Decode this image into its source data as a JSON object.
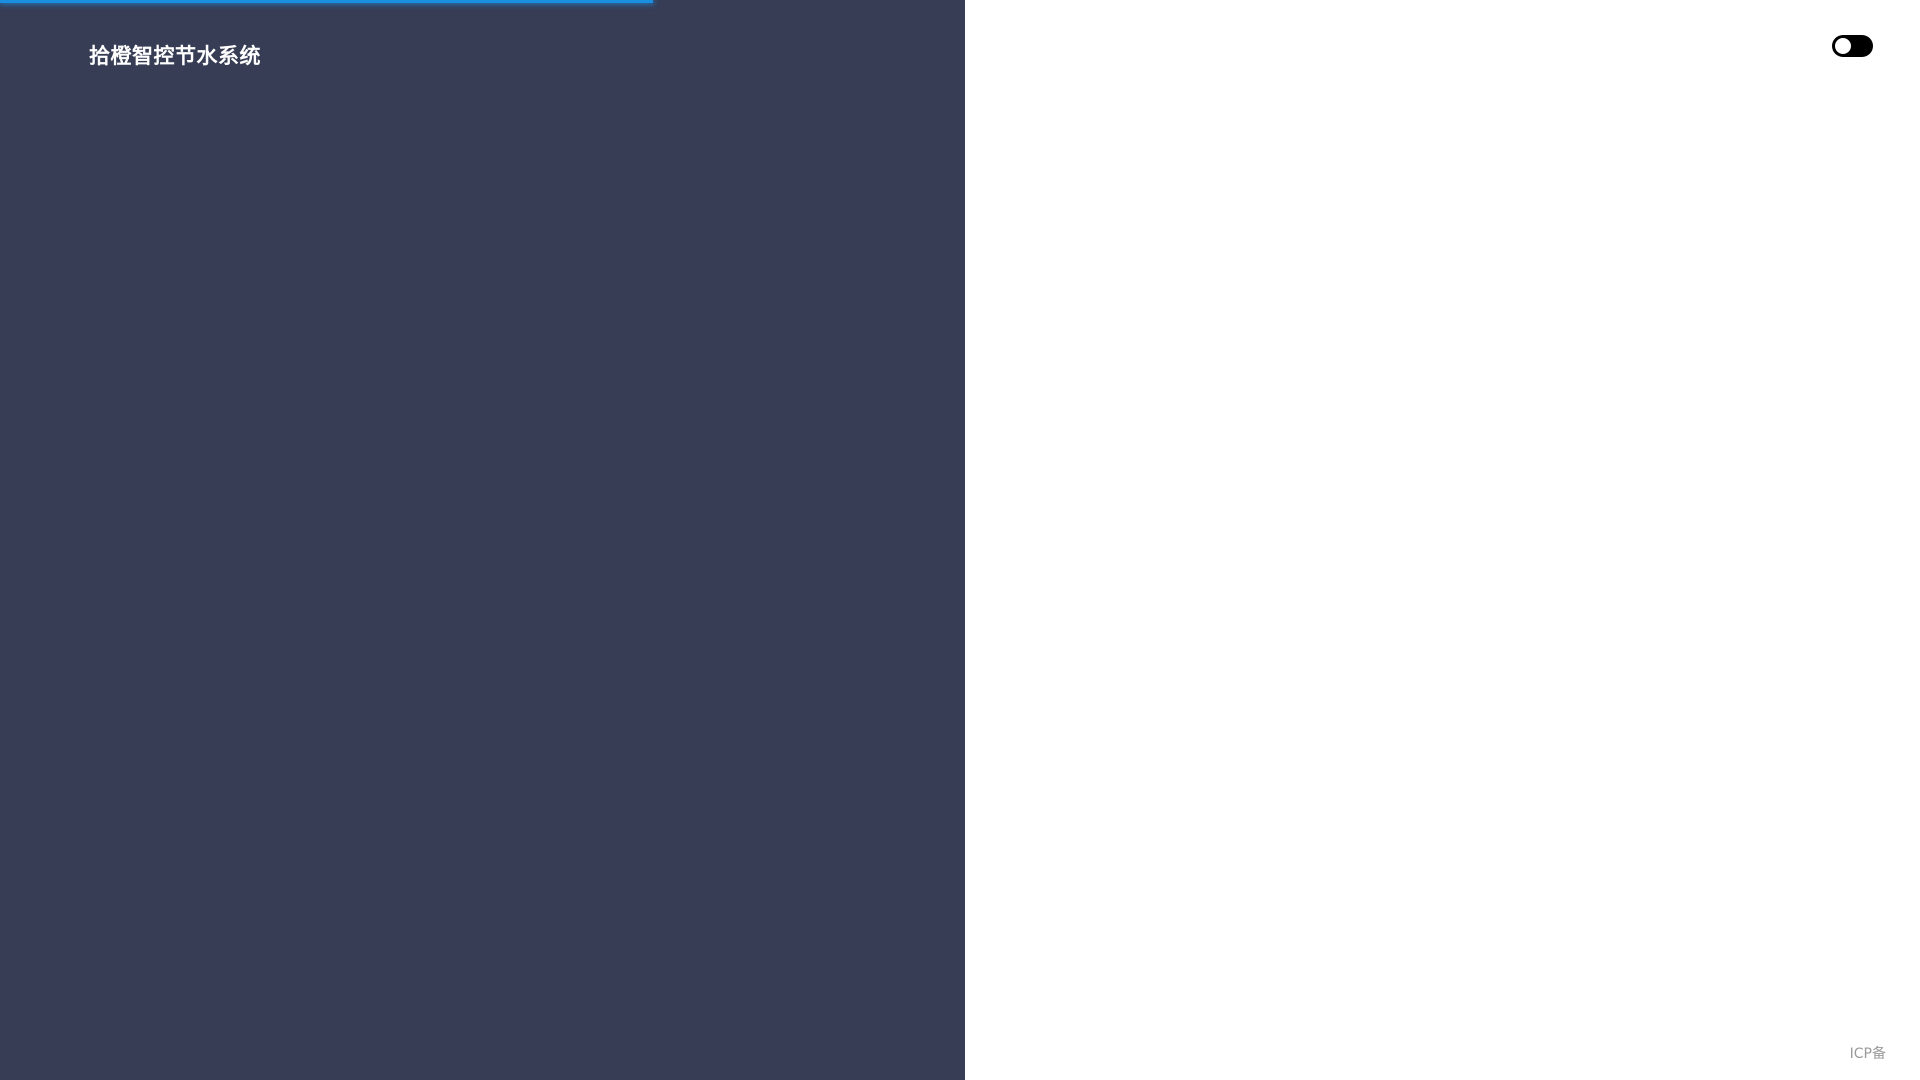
{
  "app": {
    "title": "拾橙智控节水系统"
  },
  "loading": {
    "progress_percent": 34,
    "color": "#1a8fe0"
  },
  "theme": {
    "left_panel_color": "#373d55",
    "right_panel_color": "#ffffff",
    "toggle_state": "dark"
  },
  "footer": {
    "icp_label": "ICP备"
  }
}
